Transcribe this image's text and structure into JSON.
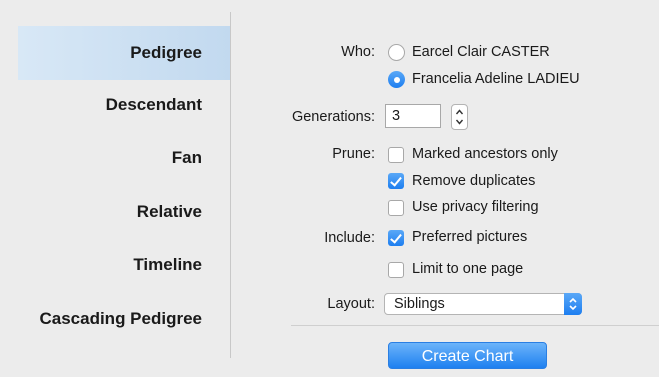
{
  "sidebar": {
    "items": [
      {
        "label": "Pedigree",
        "selected": true
      },
      {
        "label": "Descendant",
        "selected": false
      },
      {
        "label": "Fan",
        "selected": false
      },
      {
        "label": "Relative",
        "selected": false
      },
      {
        "label": "Timeline",
        "selected": false
      },
      {
        "label": "Cascading Pedigree",
        "selected": false
      }
    ]
  },
  "form": {
    "who": {
      "label": "Who:",
      "options": [
        {
          "label": "Earcel Clair CASTER",
          "selected": false
        },
        {
          "label": "Francelia Adeline LADIEU",
          "selected": true
        }
      ]
    },
    "generations": {
      "label": "Generations:",
      "value": "3"
    },
    "prune": {
      "label": "Prune:",
      "options": [
        {
          "label": "Marked ancestors only",
          "checked": false
        },
        {
          "label": "Remove duplicates",
          "checked": true
        },
        {
          "label": "Use privacy filtering",
          "checked": false
        }
      ]
    },
    "include": {
      "label": "Include:",
      "options": [
        {
          "label": "Preferred pictures",
          "checked": true
        },
        {
          "label": "Limit to one page",
          "checked": false
        }
      ]
    },
    "layout": {
      "label": "Layout:",
      "value": "Siblings"
    }
  },
  "actions": {
    "create_label": "Create Chart"
  },
  "colors": {
    "accent": "#1d7ef0",
    "selection": "#c2d9ef"
  },
  "icons": {
    "stepper": "up-down-chevron-icon",
    "select": "up-down-chevron-icon"
  }
}
